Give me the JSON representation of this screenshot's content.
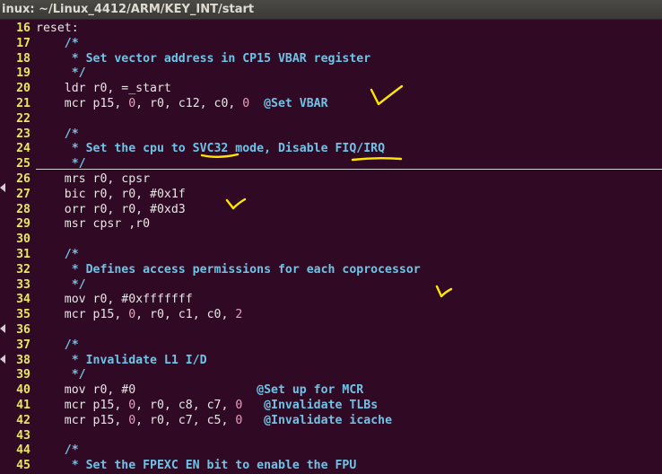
{
  "window": {
    "title": "inux: ~/Linux_4412/ARM/KEY_INT/start"
  },
  "colors": {
    "background": "#300a24",
    "line_number": "#e8e85a",
    "comment": "#6ec3e6",
    "number": "#e8a0c0",
    "annotation": "#ffe600"
  },
  "lines": [
    {
      "n": "16",
      "tokens": [
        {
          "t": "reset:",
          "c": "kw"
        }
      ]
    },
    {
      "n": "17",
      "tokens": [
        {
          "t": "    /*",
          "c": "cm"
        }
      ]
    },
    {
      "n": "18",
      "tokens": [
        {
          "t": "     * Set vector address in CP15 VBAR register",
          "c": "cm"
        }
      ]
    },
    {
      "n": "19",
      "tokens": [
        {
          "t": "     */",
          "c": "cm"
        }
      ]
    },
    {
      "n": "20",
      "tokens": [
        {
          "t": "    ldr r0, =_start",
          "c": "kw"
        }
      ]
    },
    {
      "n": "21",
      "tokens": [
        {
          "t": "    mcr p15, ",
          "c": "kw"
        },
        {
          "t": "0",
          "c": "num"
        },
        {
          "t": ", r0, c12, c0, ",
          "c": "kw"
        },
        {
          "t": "0",
          "c": "num"
        },
        {
          "t": "  ",
          "c": "kw"
        },
        {
          "t": "@Set VBAR",
          "c": "lbl"
        }
      ]
    },
    {
      "n": "22",
      "tokens": []
    },
    {
      "n": "23",
      "tokens": [
        {
          "t": "    /*",
          "c": "cm"
        }
      ]
    },
    {
      "n": "24",
      "tokens": [
        {
          "t": "     * Set the cpu to SVC32 mode, Disable FIQ/IRQ",
          "c": "cm"
        }
      ]
    },
    {
      "n": "25",
      "tokens": [
        {
          "t": "     */",
          "c": "cm"
        }
      ]
    },
    {
      "n": "26",
      "tokens": [
        {
          "t": "    mrs r0, cpsr",
          "c": "kw"
        }
      ]
    },
    {
      "n": "27",
      "tokens": [
        {
          "t": "    bic r0, r0, #0x1f",
          "c": "kw"
        }
      ]
    },
    {
      "n": "28",
      "tokens": [
        {
          "t": "    orr r0, r0, #0xd3",
          "c": "kw"
        }
      ]
    },
    {
      "n": "29",
      "tokens": [
        {
          "t": "    msr cpsr ,r0",
          "c": "kw"
        }
      ]
    },
    {
      "n": "30",
      "tokens": []
    },
    {
      "n": "31",
      "tokens": [
        {
          "t": "    /*",
          "c": "cm"
        }
      ]
    },
    {
      "n": "32",
      "tokens": [
        {
          "t": "     * Defines access permissions for each coprocessor",
          "c": "cm"
        }
      ]
    },
    {
      "n": "33",
      "tokens": [
        {
          "t": "     */",
          "c": "cm"
        }
      ]
    },
    {
      "n": "34",
      "tokens": [
        {
          "t": "    mov r0, #0xfffffff",
          "c": "kw"
        }
      ]
    },
    {
      "n": "35",
      "tokens": [
        {
          "t": "    mcr p15, ",
          "c": "kw"
        },
        {
          "t": "0",
          "c": "num"
        },
        {
          "t": ", r0, c1, c0, ",
          "c": "kw"
        },
        {
          "t": "2",
          "c": "num"
        }
      ]
    },
    {
      "n": "36",
      "tokens": []
    },
    {
      "n": "37",
      "tokens": [
        {
          "t": "    /*",
          "c": "cm"
        }
      ]
    },
    {
      "n": "38",
      "tokens": [
        {
          "t": "     * Invalidate L1 I/D",
          "c": "cm"
        }
      ]
    },
    {
      "n": "39",
      "tokens": [
        {
          "t": "     */",
          "c": "cm"
        }
      ]
    },
    {
      "n": "40",
      "tokens": [
        {
          "t": "    mov r0, #0                 ",
          "c": "kw"
        },
        {
          "t": "@Set up for MCR",
          "c": "lbl"
        }
      ]
    },
    {
      "n": "41",
      "tokens": [
        {
          "t": "    mcr p15, ",
          "c": "kw"
        },
        {
          "t": "0",
          "c": "num"
        },
        {
          "t": ", r0, c8, c7, ",
          "c": "kw"
        },
        {
          "t": "0",
          "c": "num"
        },
        {
          "t": "   ",
          "c": "kw"
        },
        {
          "t": "@Invalidate TLBs",
          "c": "lbl"
        }
      ]
    },
    {
      "n": "42",
      "tokens": [
        {
          "t": "    mcr p15, ",
          "c": "kw"
        },
        {
          "t": "0",
          "c": "num"
        },
        {
          "t": ", r0, c7, c5, ",
          "c": "kw"
        },
        {
          "t": "0",
          "c": "num"
        },
        {
          "t": "   ",
          "c": "kw"
        },
        {
          "t": "@Invalidate icache",
          "c": "lbl"
        }
      ]
    },
    {
      "n": "43",
      "tokens": []
    },
    {
      "n": "44",
      "tokens": [
        {
          "t": "    /*",
          "c": "cm"
        }
      ]
    },
    {
      "n": "45",
      "tokens": [
        {
          "t": "     * Set the FPEXC EN bit to enable the FPU",
          "c": "cm"
        }
      ]
    }
  ]
}
